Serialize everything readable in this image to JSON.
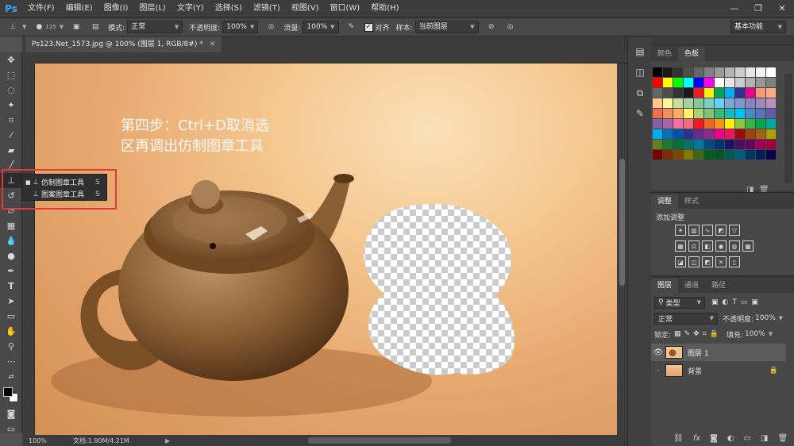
{
  "app": {
    "logo": "Ps"
  },
  "menu": [
    "文件(F)",
    "编辑(E)",
    "图像(I)",
    "图层(L)",
    "文字(Y)",
    "选择(S)",
    "滤镜(T)",
    "视图(V)",
    "窗口(W)",
    "帮助(H)"
  ],
  "window_controls": {
    "minimize": "—",
    "restore": "❐",
    "close": "✕"
  },
  "options": {
    "brush_size": "125",
    "mode_label": "模式:",
    "mode_value": "正常",
    "opacity_label": "不透明度:",
    "opacity_value": "100%",
    "flow_label": "流量:",
    "flow_value": "100%",
    "aligned_label": "对齐",
    "sample_label": "样本:",
    "sample_value": "当前图层",
    "workspace": "基本功能"
  },
  "document": {
    "tab_title": "Ps123.Net_1573.jpg @ 100% (图层 1, RGB/8#) *"
  },
  "canvas": {
    "instruction_line1": "第四步：Ctrl+D取消选",
    "instruction_line2": "区再调出仿制图章工具"
  },
  "flyout": {
    "items": [
      {
        "label": "仿制图章工具",
        "key": "S",
        "active": true
      },
      {
        "label": "图案图章工具",
        "key": "S",
        "active": false
      }
    ]
  },
  "status": {
    "zoom": "100%",
    "doc_info": "文档:1.90M/4.21M"
  },
  "panels": {
    "color_tabs": [
      "颜色",
      "色板"
    ],
    "swatches": [
      "#000000",
      "#1a1a1a",
      "#333333",
      "#4d4d4d",
      "#666666",
      "#808080",
      "#999999",
      "#b3b3b3",
      "#cccccc",
      "#e6e6e6",
      "#f2f2f2",
      "#ffffff",
      "#ff0000",
      "#ffff00",
      "#00ff00",
      "#00ffff",
      "#0000ff",
      "#ff00ff",
      "#ffffff",
      "#e6e6e6",
      "#cccccc",
      "#b3b3b3",
      "#999999",
      "#808080",
      "#666666",
      "#4d4d4d",
      "#333333",
      "#1a1a1a",
      "#ed1c24",
      "#fff200",
      "#00a651",
      "#00aeef",
      "#2e3192",
      "#ec008c",
      "#f7977a",
      "#fbad82",
      "#fdc68a",
      "#fff79a",
      "#c4df9b",
      "#a3d39c",
      "#82ca9d",
      "#7bcdc8",
      "#6ecff6",
      "#7ea7d8",
      "#8493ca",
      "#8882be",
      "#a187be",
      "#bc8dbf",
      "#f26c4f",
      "#f68e55",
      "#fbaf5c",
      "#fff467",
      "#acd372",
      "#7cc576",
      "#3bb878",
      "#1abbb4",
      "#00bff3",
      "#438cca",
      "#5574b9",
      "#605ca8",
      "#855fa8",
      "#a763a8",
      "#f06ea9",
      "#f26d7d",
      "#ed1c24",
      "#f26522",
      "#f7941d",
      "#fff200",
      "#8dc63f",
      "#39b54a",
      "#00a651",
      "#00a99d",
      "#00aeef",
      "#0072bc",
      "#0054a6",
      "#2e3192",
      "#662d91",
      "#92278f",
      "#ec008c",
      "#ed145b",
      "#9e0b0f",
      "#a0410d",
      "#a36209",
      "#aba000",
      "#598527",
      "#1a7b30",
      "#007236",
      "#00746b",
      "#0076a3",
      "#004b80",
      "#003471",
      "#1b1464",
      "#440e62",
      "#630460",
      "#9e005d",
      "#9e0039",
      "#790000",
      "#7b2e00",
      "#7d4900",
      "#827b00",
      "#406618",
      "#005e20",
      "#005826",
      "#005952",
      "#005b7f",
      "#003663",
      "#002157",
      "#0d004c"
    ],
    "adj_tabs": [
      "调整",
      "样式"
    ],
    "adj_title": "添加调整",
    "layers_tabs": [
      "图层",
      "通道",
      "路径"
    ],
    "layers_filter": "类型",
    "blend_mode": "正常",
    "layer_opacity_label": "不透明度:",
    "layer_opacity_value": "100%",
    "lock_label": "锁定:",
    "fill_label": "填充:",
    "fill_value": "100%",
    "layers": [
      {
        "name": "图层 1",
        "selected": true,
        "locked": false
      },
      {
        "name": "背景",
        "selected": false,
        "locked": true
      }
    ]
  }
}
